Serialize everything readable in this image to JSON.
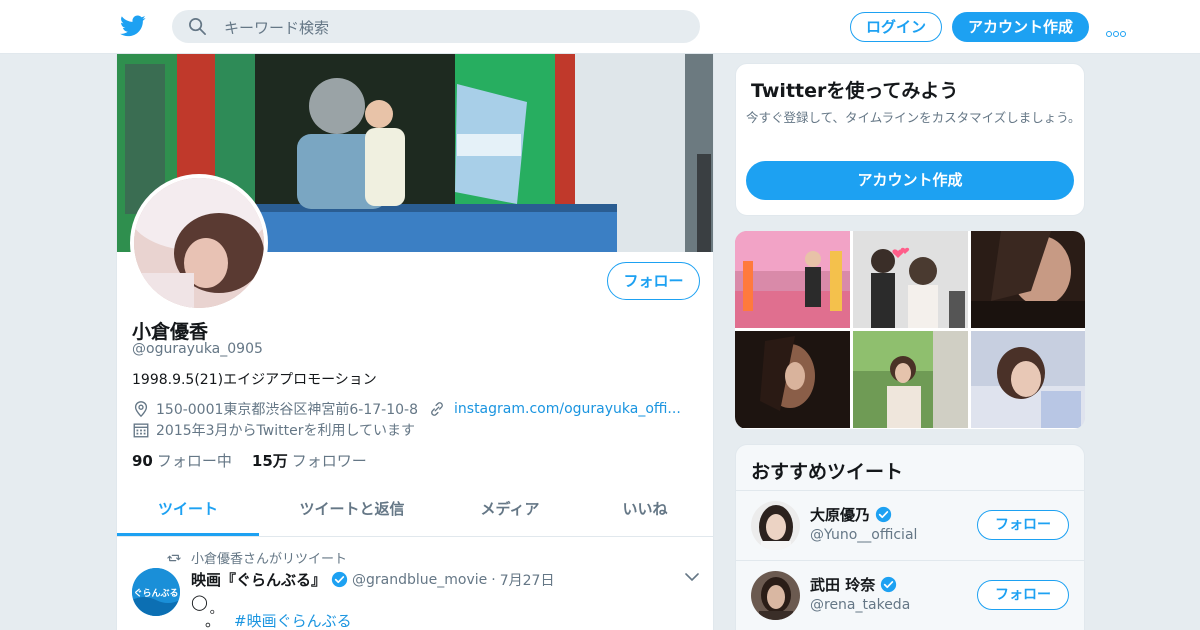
{
  "topbar": {
    "search_placeholder": "キーワード検索",
    "login_label": "ログイン",
    "signup_label": "アカウント作成"
  },
  "profile": {
    "follow_label": "フォロー",
    "name": "小倉優香",
    "handle": "@ogurayuka_0905",
    "bio": "1998.9.5(21)エイジアプロモーション",
    "location": "150-0001東京都渋谷区神宮前6-17-10-8",
    "url": "instagram.com/ogurayuka_offi...",
    "joined": "2015年3月からTwitterを利用しています",
    "following_count": "90",
    "following_label": "フォロー中",
    "followers_count": "15万",
    "followers_label": "フォロワー"
  },
  "tabs": [
    {
      "label": "ツイート"
    },
    {
      "label": "ツイートと返信"
    },
    {
      "label": "メディア"
    },
    {
      "label": "いいね"
    }
  ],
  "tweet": {
    "retweet_context": "小倉優香さんがリツイート",
    "author_name": "映画『ぐらんぶる』",
    "author_handle": "@grandblue_movie",
    "separator": "·",
    "date": "7月27日",
    "line1": "◯",
    "line1b": "。",
    "line2": "。",
    "hashtag": "#映画ぐらんぶる",
    "avatar_text": "ぐらんぶる"
  },
  "sidebar": {
    "try_title": "Twitterを使ってみよう",
    "try_desc": "今すぐ登録して、タイムラインをカスタマイズしましょう。",
    "try_button": "アカウント作成",
    "rec_title": "おすすめツイート",
    "rec_users": [
      {
        "name": "大原優乃",
        "handle": "@Yuno__official",
        "follow_label": "フォロー"
      },
      {
        "name": "武田 玲奈",
        "handle": "@rena_takeda",
        "follow_label": "フォロー"
      }
    ]
  },
  "colors": {
    "accent": "#1da1f2",
    "link": "#1b95e0",
    "muted": "#657786",
    "background": "#e6ecf0"
  },
  "icons": [
    "twitter-bird-icon",
    "search-icon",
    "more-icon",
    "location-icon",
    "link-icon",
    "calendar-icon",
    "retweet-icon",
    "verified-icon",
    "chevron-down-icon"
  ]
}
